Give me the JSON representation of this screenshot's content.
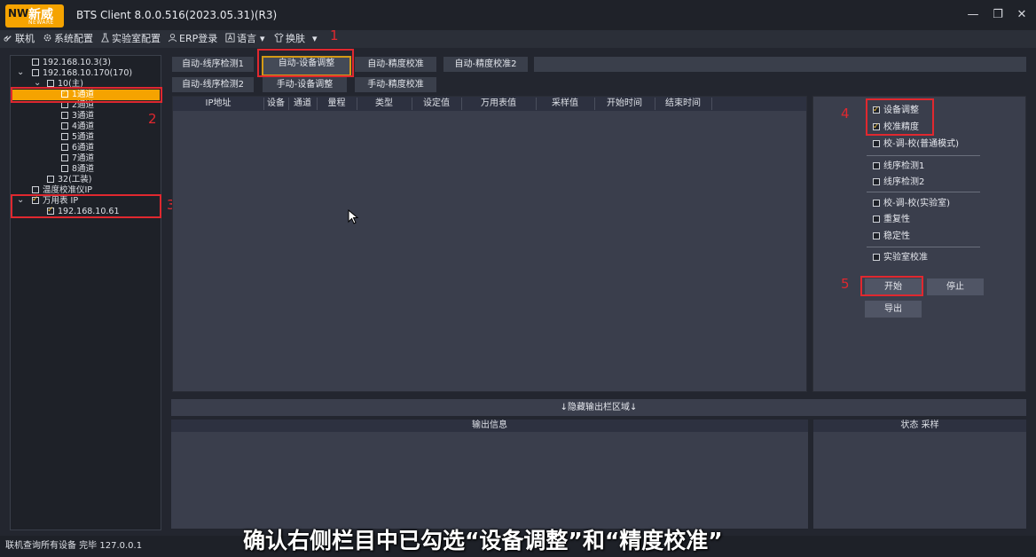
{
  "window": {
    "logo_cn": "新威",
    "logo_en": "NEWARE",
    "logo_mark": "NW",
    "title": "BTS Client 8.0.0.516(2023.05.31)(R3)",
    "controls": {
      "minimize": "—",
      "restore": "❐",
      "close": "✕"
    }
  },
  "menu": [
    {
      "label": "联机",
      "icon": "link-icon"
    },
    {
      "label": "系统配置",
      "icon": "gear-icon"
    },
    {
      "label": "实验室配置",
      "icon": "flask-icon"
    },
    {
      "label": "ERP登录",
      "icon": "user-icon"
    },
    {
      "label": "语言",
      "icon": "language-icon"
    },
    {
      "label": "换肤",
      "icon": "shirt-icon"
    }
  ],
  "menu_dropdown_arrows": [
    "▾",
    "▾"
  ],
  "tree": {
    "nodes": [
      {
        "label": "192.168.10.3(3)",
        "checked": false
      },
      {
        "label": "192.168.10.170(170)",
        "checked": false,
        "expanded": true
      },
      {
        "label": "10(主)",
        "checked": false,
        "expanded": true
      },
      {
        "label": "1通道",
        "checked": true,
        "selected": true
      },
      {
        "label": "2通道",
        "checked": false
      },
      {
        "label": "3通道",
        "checked": false
      },
      {
        "label": "4通道",
        "checked": false
      },
      {
        "label": "5通道",
        "checked": false
      },
      {
        "label": "6通道",
        "checked": false
      },
      {
        "label": "7通道",
        "checked": false
      },
      {
        "label": "8通道",
        "checked": false
      },
      {
        "label": "32(工装)",
        "checked": false
      },
      {
        "label": "温度校准仪IP",
        "checked": false
      },
      {
        "label": "万用表 IP",
        "checked": true,
        "expanded": true
      },
      {
        "label": "192.168.10.61",
        "checked": true
      }
    ]
  },
  "tabs": {
    "row1": [
      "自动-线序检测1",
      "自动-设备调整",
      "自动-精度校准",
      "自动-精度校准2"
    ],
    "row2": [
      "自动-线序检测2",
      "手动-设备调整",
      "手动-精度校准"
    ],
    "active": "自动-设备调整"
  },
  "grid": {
    "columns": [
      "IP地址",
      "设备",
      "通道",
      "量程",
      "类型",
      "设定值",
      "万用表值",
      "采样值",
      "开始时间",
      "结束时间"
    ]
  },
  "options": [
    {
      "label": "设备调整",
      "checked": true
    },
    {
      "label": "校准精度",
      "checked": true
    },
    {
      "label": "校-调-校(普通模式)",
      "checked": false
    },
    {
      "label": "线序检测1",
      "checked": false
    },
    {
      "label": "线序检测2",
      "checked": false
    },
    {
      "label": "校-调-校(实验室)",
      "checked": false
    },
    {
      "label": "重复性",
      "checked": false
    },
    {
      "label": "稳定性",
      "checked": false
    },
    {
      "label": "实验室校准",
      "checked": false
    }
  ],
  "buttons": {
    "start": "开始",
    "stop": "停止",
    "export": "导出"
  },
  "annotations": {
    "n1": "1",
    "n2": "2",
    "n3": "3",
    "n4": "4",
    "n5": "5"
  },
  "bottom": {
    "hide_bar": "↓隐藏输出栏区域↓",
    "output_header": "输出信息",
    "status_header": "状态 采样"
  },
  "statusbar": {
    "text": "联机查询所有设备 完毕 127.0.0.1"
  },
  "subtitle": "确认右侧栏目中已勾选“设备调整”和“精度校准”",
  "colors": {
    "accent": "#f5a300",
    "highlight_box": "#e0282f",
    "active_tab_border": "#d49a16"
  }
}
